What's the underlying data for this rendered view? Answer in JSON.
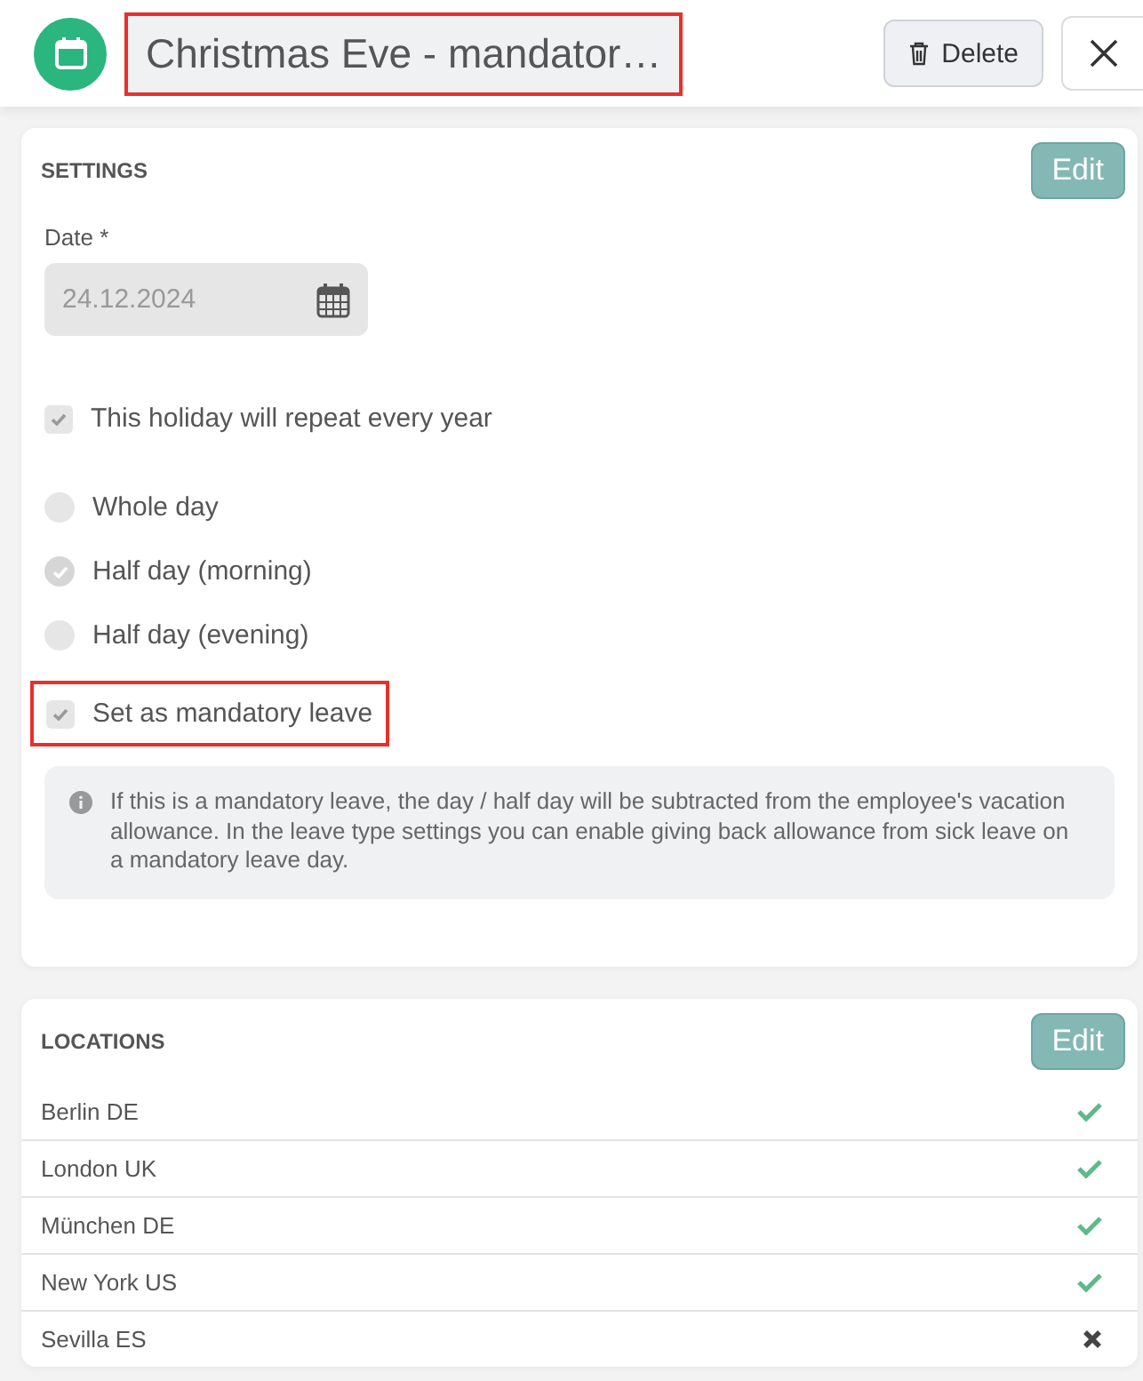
{
  "header": {
    "title": "Christmas Eve - mandator…",
    "title_highlighted": true,
    "delete_button": "Delete"
  },
  "settings": {
    "heading": "SETTINGS",
    "edit_button": "Edit",
    "date": {
      "label": "Date *",
      "value": "24.12.2024"
    },
    "repeat": {
      "label": "This holiday will repeat every year",
      "checked": true
    },
    "durations": [
      {
        "label": "Whole day",
        "selected": false
      },
      {
        "label": "Half day (morning)",
        "selected": true
      },
      {
        "label": "Half day (evening)",
        "selected": false
      }
    ],
    "mandatory": {
      "label": "Set as mandatory leave",
      "checked": true,
      "highlighted": true
    },
    "info": "If this is a mandatory leave, the day / half day will be subtracted from the employee's vacation allowance. In the leave type settings you can enable giving back allowance from sick leave on a mandatory leave day."
  },
  "locations": {
    "heading": "LOCATIONS",
    "edit_button": "Edit",
    "items": [
      {
        "name": "Berlin DE",
        "included": true
      },
      {
        "name": "London UK",
        "included": true
      },
      {
        "name": "München DE",
        "included": true
      },
      {
        "name": "New York US",
        "included": true
      },
      {
        "name": "Sevilla ES",
        "included": false
      }
    ]
  }
}
